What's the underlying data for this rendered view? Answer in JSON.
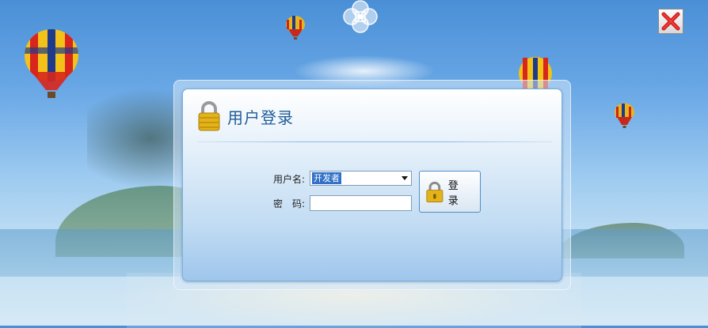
{
  "window": {
    "close_label": "×"
  },
  "login": {
    "title": "用户登录",
    "username_label": "用户名:",
    "username_value": "开发者",
    "password_label": "密　码:",
    "password_value": "",
    "login_button_label": "登 录"
  },
  "colors": {
    "title_blue": "#1f5a9a",
    "close_red": "#d21a1a",
    "selection_blue": "#3170c8"
  },
  "icons": {
    "close": "close-x-icon",
    "lock": "padlock-icon",
    "emblem": "clover-emblem-icon",
    "balloon": "hot-air-balloon-icon"
  }
}
